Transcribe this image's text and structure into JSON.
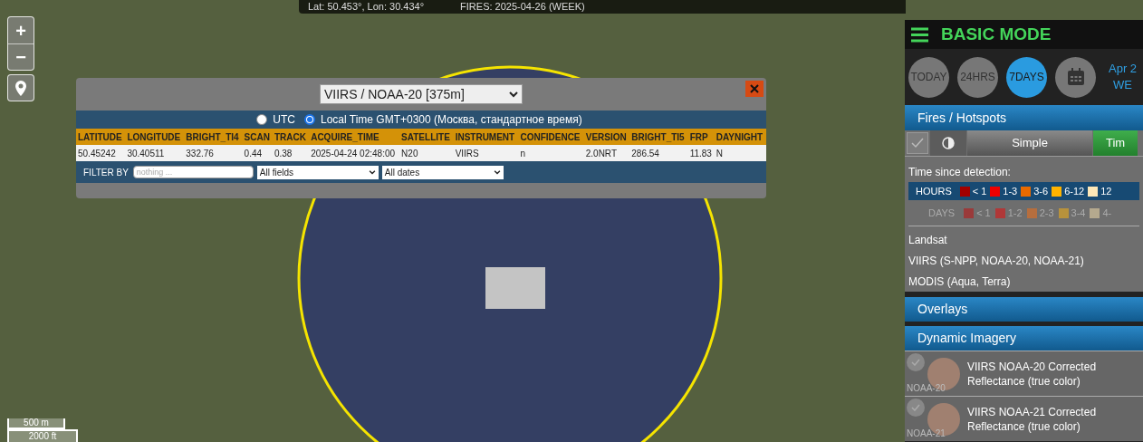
{
  "top_bar": {
    "coordinates": "Lat: 50.453°, Lon: 30.434°",
    "fires": "FIRES: 2025-04-26 (WEEK)"
  },
  "map_controls": {
    "zoom_in": "+",
    "zoom_out": "−"
  },
  "scale_bar": {
    "metric": "500 m",
    "imperial": "2000 ft"
  },
  "popup": {
    "sensor_select": "VIIRS / NOAA-20 [375m]",
    "time_options": [
      {
        "label": "UTC",
        "selected": false
      },
      {
        "label": "Local Time GMT+0300 (Москва, стандартное время)",
        "selected": true
      }
    ],
    "table": {
      "columns": [
        "LATITUDE",
        "LONGITUDE",
        "BRIGHT_TI4",
        "SCAN",
        "TRACK",
        "ACQUIRE_TIME",
        "SATELLITE",
        "INSTRUMENT",
        "CONFIDENCE",
        "VERSION",
        "BRIGHT_TI5",
        "FRP",
        "DAYNIGHT"
      ],
      "rows": [
        [
          "50.45242",
          "30.40511",
          "332.76",
          "0.44",
          "0.38",
          "2025-04-24 02:48:00",
          "N20",
          "VIIRS",
          "n",
          "2.0NRT",
          "286.54",
          "11.83",
          "N"
        ]
      ]
    },
    "filter": {
      "label": "FILTER BY",
      "placeholder": "nothing ...",
      "field_select": "All fields",
      "date_select": "All dates"
    }
  },
  "sidebar": {
    "mode_title": "BASIC MODE",
    "range_buttons": [
      {
        "kind": "text",
        "label": "TODAY",
        "selected": false
      },
      {
        "kind": "text",
        "label": "24HRS",
        "selected": false
      },
      {
        "kind": "text",
        "label": "7DAYS",
        "selected": true
      },
      {
        "kind": "calendar",
        "selected": false
      }
    ],
    "date_lines": [
      "Apr 2",
      "WE"
    ],
    "fires_section": {
      "title": "Fires / Hotspots",
      "visible": true,
      "style_tabs": [
        {
          "label": "Simple",
          "selected": false
        },
        {
          "label": "Tim",
          "selected": true
        }
      ],
      "legend_title": "Time since detection:",
      "legend_rows": [
        {
          "label": "HOURS",
          "selected": true,
          "items": [
            {
              "label": "< 1",
              "color": "#a30000"
            },
            {
              "label": "1-3",
              "color": "#f00000"
            },
            {
              "label": "3-6",
              "color": "#e86a00"
            },
            {
              "label": "6-12",
              "color": "#ffb300"
            },
            {
              "label": "12",
              "color": "#fde8b8"
            }
          ]
        },
        {
          "label": "DAYS",
          "selected": false,
          "items": [
            {
              "label": "< 1",
              "color": "#9a3a3a"
            },
            {
              "label": "1-2",
              "color": "#b03838"
            },
            {
              "label": "2-3",
              "color": "#b66e3e"
            },
            {
              "label": "3-4",
              "color": "#b8923c"
            },
            {
              "label": "4-",
              "color": "#b5a98e"
            }
          ]
        }
      ],
      "sources": [
        "Landsat",
        "VIIRS (S-NPP, NOAA-20, NOAA-21)",
        "MODIS (Aqua, Terra)"
      ]
    },
    "overlays_title": "Overlays",
    "imagery_section": {
      "title": "Dynamic Imagery",
      "layers": [
        {
          "badge": "NOAA-20",
          "title": "VIIRS NOAA-20 Corrected Reflectance (true color)",
          "checked": false
        },
        {
          "badge": "NOAA-21",
          "title": "VIIRS NOAA-21 Corrected Reflectance (true color)",
          "checked": false
        }
      ]
    }
  }
}
